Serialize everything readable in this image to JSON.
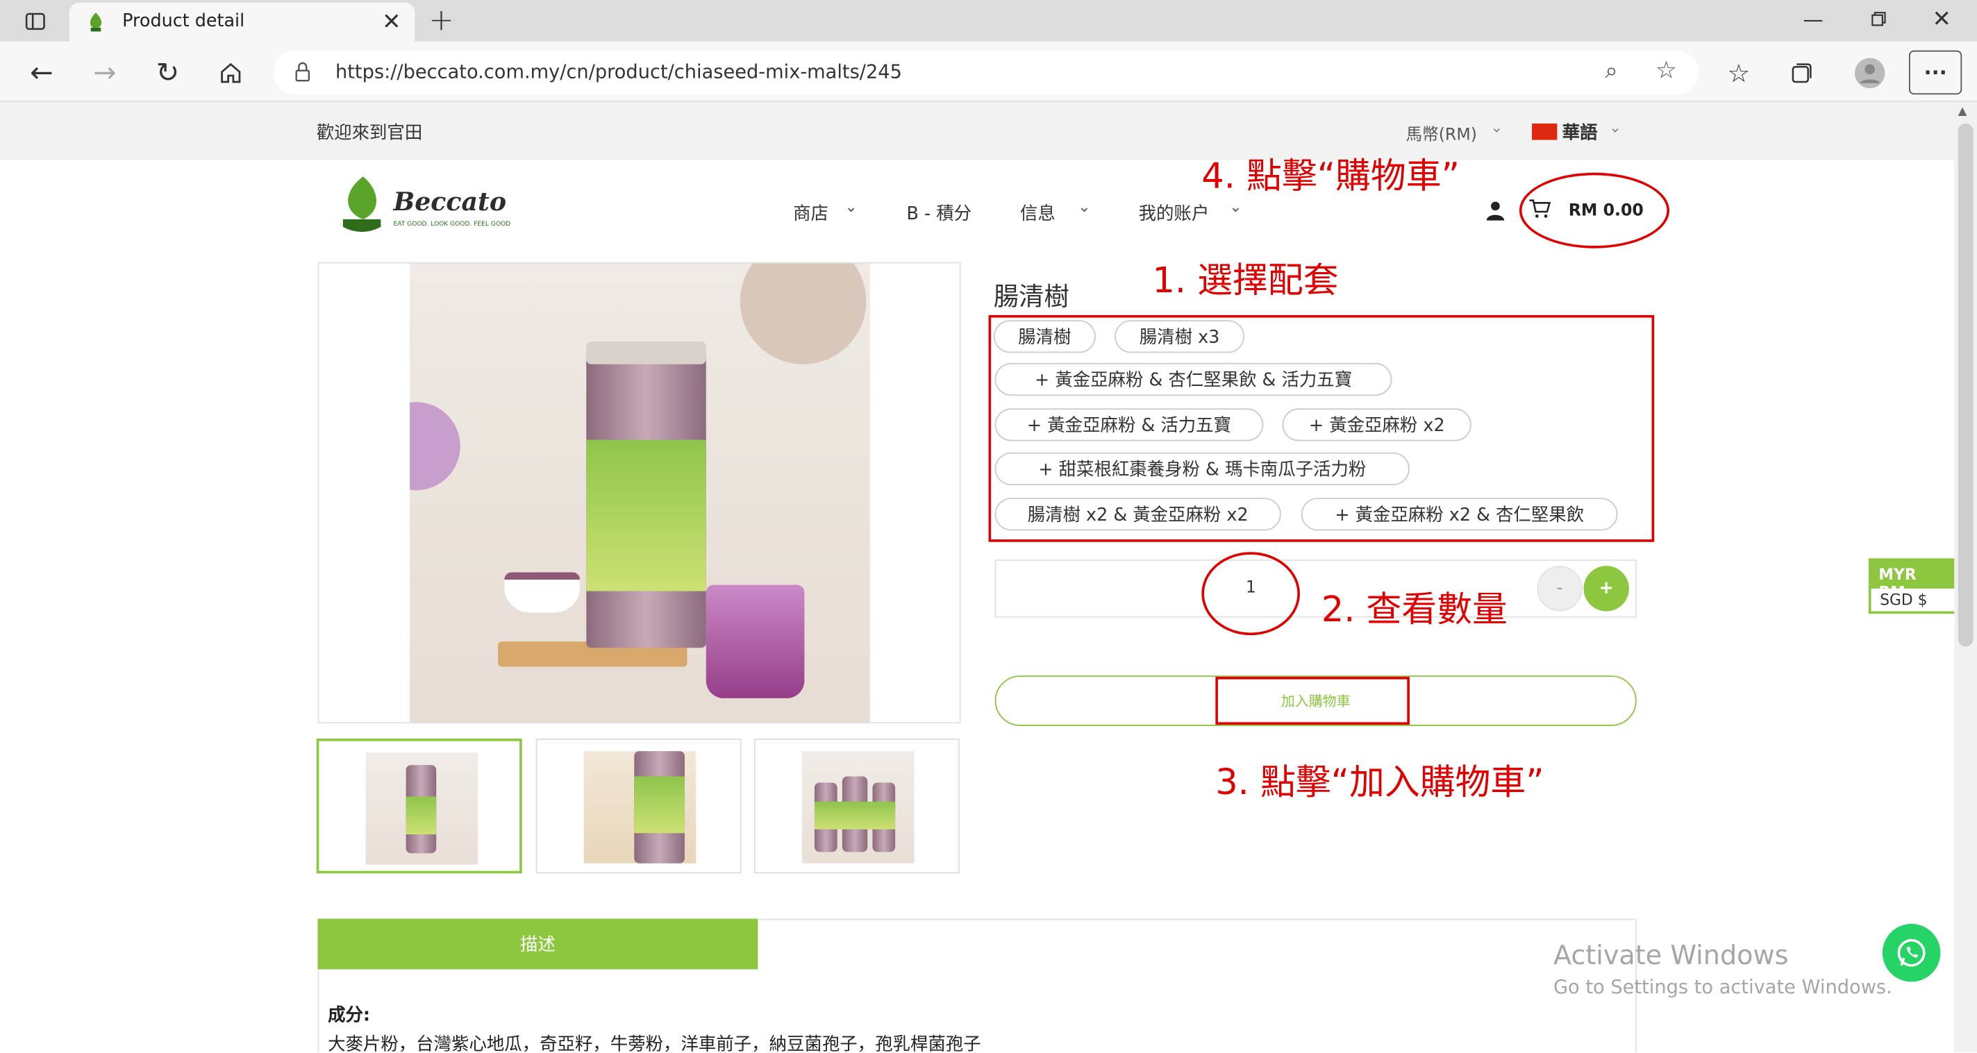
{
  "browser": {
    "tab_title": "Product detail",
    "url": "https://beccato.com.my/cn/product/chiaseed-mix-malts/245"
  },
  "utilbar": {
    "welcome": "歡迎來到官田",
    "currency": "馬幣(RM)",
    "language": "華語"
  },
  "header": {
    "logo_text": "Beccato",
    "logo_tagline": "EAT GOOD. LOOK GOOD. FEEL GOOD",
    "nav": [
      "商店",
      "B - 積分",
      "信息",
      "我的账户"
    ],
    "cart_total": "RM 0.00"
  },
  "product": {
    "name": "腸清樹",
    "options": [
      "腸清樹",
      "腸清樹 x3",
      "+ 黃金亞麻粉 & 杏仁堅果飲 & 活力五寶",
      "+ 黃金亞麻粉 & 活力五寶",
      "+ 黃金亞麻粉 x2",
      "+ 甜菜根紅棗養身粉 & 瑪卡南瓜子活力粉",
      "腸清樹 x2 & 黃金亞麻粉 x2",
      "+ 黃金亞麻粉 x2 & 杏仁堅果飲"
    ],
    "quantity": "1",
    "minus": "-",
    "plus": "+",
    "add_to_cart": "加入購物車"
  },
  "annotations": {
    "step1": "1. 選擇配套",
    "step2": "2. 查看數量",
    "step3": "3. 點擊“加入購物車”",
    "step4": "4. 點擊“購物車”"
  },
  "tabs": {
    "description": "描述"
  },
  "description": {
    "heading": "成分:",
    "ingredients": "大麥片粉，台灣紫心地瓜，奇亞籽，牛蒡粉，洋車前子，納豆菌孢子，孢乳桿菌孢子"
  },
  "currency_widget": {
    "line1": "MYR RM",
    "line2": "SGD $"
  },
  "os_watermark": {
    "line1": "Activate Windows",
    "line2": "Go to Settings to activate Windows."
  },
  "colors": {
    "brand_green": "#8dc63f",
    "annotation_red": "#e00000"
  }
}
